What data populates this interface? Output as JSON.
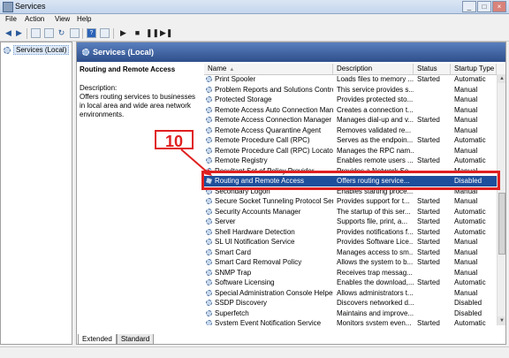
{
  "window": {
    "title": "Services",
    "min": "_",
    "max": "□",
    "close": "×"
  },
  "menu": [
    "File",
    "Action",
    "View",
    "Help"
  ],
  "tree": {
    "item": "Services (Local)"
  },
  "header": {
    "title": "Services (Local)"
  },
  "description": {
    "title": "Routing and Remote Access",
    "label": "Description:",
    "text": "Offers routing services to businesses in local area and wide area network environments."
  },
  "columns": {
    "name": "Name",
    "description": "Description",
    "status": "Status",
    "startup": "Startup Type"
  },
  "services": [
    {
      "name": "Print Spooler",
      "description": "Loads files to memory ...",
      "status": "Started",
      "startup": "Automatic"
    },
    {
      "name": "Problem Reports and Solutions Contro...",
      "description": "This service provides s...",
      "status": "",
      "startup": "Manual"
    },
    {
      "name": "Protected Storage",
      "description": "Provides protected sto...",
      "status": "",
      "startup": "Manual"
    },
    {
      "name": "Remote Access Auto Connection Man...",
      "description": "Creates a connection t...",
      "status": "",
      "startup": "Manual"
    },
    {
      "name": "Remote Access Connection Manager",
      "description": "Manages dial-up and v...",
      "status": "Started",
      "startup": "Manual"
    },
    {
      "name": "Remote Access Quarantine Agent",
      "description": "Removes validated re...",
      "status": "",
      "startup": "Manual"
    },
    {
      "name": "Remote Procedure Call (RPC)",
      "description": "Serves as the endpoin...",
      "status": "Started",
      "startup": "Automatic"
    },
    {
      "name": "Remote Procedure Call (RPC) Locator",
      "description": "Manages the RPC nam...",
      "status": "",
      "startup": "Manual"
    },
    {
      "name": "Remote Registry",
      "description": "Enables remote users ...",
      "status": "Started",
      "startup": "Automatic"
    },
    {
      "name": "Resultant Set of Policy Provider",
      "description": "Provides a Network Se...",
      "status": "",
      "startup": "Manual"
    },
    {
      "name": "Routing and Remote Access",
      "description": "Offers routing service...",
      "status": "",
      "startup": "Disabled",
      "selected": true
    },
    {
      "name": "Secondary Logon",
      "description": "Enables starting proce...",
      "status": "",
      "startup": "Manual"
    },
    {
      "name": "Secure Socket Tunneling Protocol Ser...",
      "description": "Provides support for t...",
      "status": "Started",
      "startup": "Manual"
    },
    {
      "name": "Security Accounts Manager",
      "description": "The startup of this ser...",
      "status": "Started",
      "startup": "Automatic"
    },
    {
      "name": "Server",
      "description": "Supports file, print, a...",
      "status": "Started",
      "startup": "Automatic"
    },
    {
      "name": "Shell Hardware Detection",
      "description": "Provides notifications f...",
      "status": "Started",
      "startup": "Automatic"
    },
    {
      "name": "SL UI Notification Service",
      "description": "Provides Software Lice...",
      "status": "Started",
      "startup": "Manual"
    },
    {
      "name": "Smart Card",
      "description": "Manages access to sm...",
      "status": "Started",
      "startup": "Manual"
    },
    {
      "name": "Smart Card Removal Policy",
      "description": "Allows the system to b...",
      "status": "Started",
      "startup": "Manual"
    },
    {
      "name": "SNMP Trap",
      "description": "Receives trap messag...",
      "status": "",
      "startup": "Manual"
    },
    {
      "name": "Software Licensing",
      "description": "Enables the download,...",
      "status": "Started",
      "startup": "Automatic"
    },
    {
      "name": "Special Administration Console Helper",
      "description": "Allows administrators t...",
      "status": "",
      "startup": "Manual"
    },
    {
      "name": "SSDP Discovery",
      "description": "Discovers networked d...",
      "status": "",
      "startup": "Disabled"
    },
    {
      "name": "Superfetch",
      "description": "Maintains and improve...",
      "status": "",
      "startup": "Disabled"
    },
    {
      "name": "System Event Notification Service",
      "description": "Monitors system even...",
      "status": "Started",
      "startup": "Automatic"
    }
  ],
  "tabs": [
    "Extended",
    "Standard"
  ],
  "annotation": {
    "number": "10"
  }
}
